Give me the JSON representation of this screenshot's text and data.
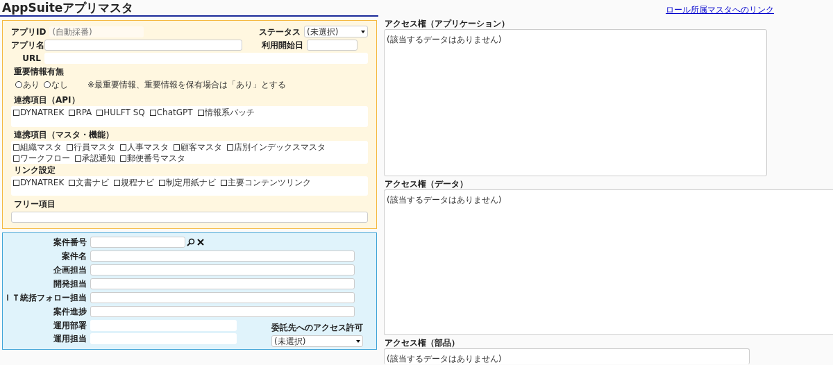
{
  "title": "AppSuiteアプリマスタ",
  "role_link": "ロール所属マスタへのリンク",
  "app_form": {
    "app_id": {
      "label": "アプリID",
      "placeholder": "(自動採番)"
    },
    "status": {
      "label": "ステータス",
      "value": "(未選択)"
    },
    "app_name": {
      "label": "アプリ名"
    },
    "start_date": {
      "label": "利用開始日"
    },
    "url": {
      "label": "URL"
    },
    "importance": {
      "label": "重要情報有無",
      "note": "※最重要情報、重要情報を保有場合は「あり」とする",
      "options": [
        {
          "label": "あり",
          "selected": false
        },
        {
          "label": "なし",
          "selected": false
        }
      ]
    },
    "checkbox_groups": [
      {
        "title": "連携項目（API）",
        "items": [
          {
            "label": "DYNATREK",
            "checked": false
          },
          {
            "label": "RPA",
            "checked": false
          },
          {
            "label": "HULFT SQ",
            "checked": false
          },
          {
            "label": "ChatGPT",
            "checked": false
          },
          {
            "label": "情報系バッチ",
            "checked": false
          }
        ]
      },
      {
        "title": "連携項目（マスタ・機能）",
        "items": [
          {
            "label": "組織マスタ",
            "checked": false
          },
          {
            "label": "行員マスタ",
            "checked": false
          },
          {
            "label": "人事マスタ",
            "checked": false
          },
          {
            "label": "顧客マスタ",
            "checked": false
          },
          {
            "label": "店別インデックスマスタ",
            "checked": false
          },
          {
            "label": "ワークフロー",
            "checked": false
          },
          {
            "label": "承認通知",
            "checked": false
          },
          {
            "label": "郵便番号マスタ",
            "checked": false
          }
        ]
      },
      {
        "title": "リンク設定",
        "items": [
          {
            "label": "DYNATREK",
            "checked": false
          },
          {
            "label": "文書ナビ",
            "checked": false
          },
          {
            "label": "規程ナビ",
            "checked": false
          },
          {
            "label": "制定用紙ナビ",
            "checked": false
          },
          {
            "label": "主要コンテンツリンク",
            "checked": false
          }
        ]
      }
    ],
    "free_item": {
      "label": "フリー項目"
    }
  },
  "project_form": {
    "fields": [
      {
        "label": "案件番号",
        "kind": "lookup"
      },
      {
        "label": "案件名",
        "kind": "wide"
      },
      {
        "label": "企画担当",
        "kind": "wide"
      },
      {
        "label": "開発担当",
        "kind": "wide"
      },
      {
        "label": "ＩＴ統括フォロー担当",
        "kind": "wide"
      },
      {
        "label": "案件進捗",
        "kind": "wide"
      },
      {
        "label": "運用部署",
        "kind": "short"
      },
      {
        "label": "運用担当",
        "kind": "short"
      }
    ],
    "consign": {
      "label": "委託先へのアクセス許可",
      "value": "(未選択)"
    }
  },
  "access_panels": [
    {
      "title": "アクセス権（アプリケーション）",
      "empty_text": "(該当するデータはありません)"
    },
    {
      "title": "アクセス権（データ）",
      "empty_text": "(該当するデータはありません)"
    },
    {
      "title": "アクセス権（部品）",
      "empty_text": "(該当するデータはありません)"
    }
  ]
}
